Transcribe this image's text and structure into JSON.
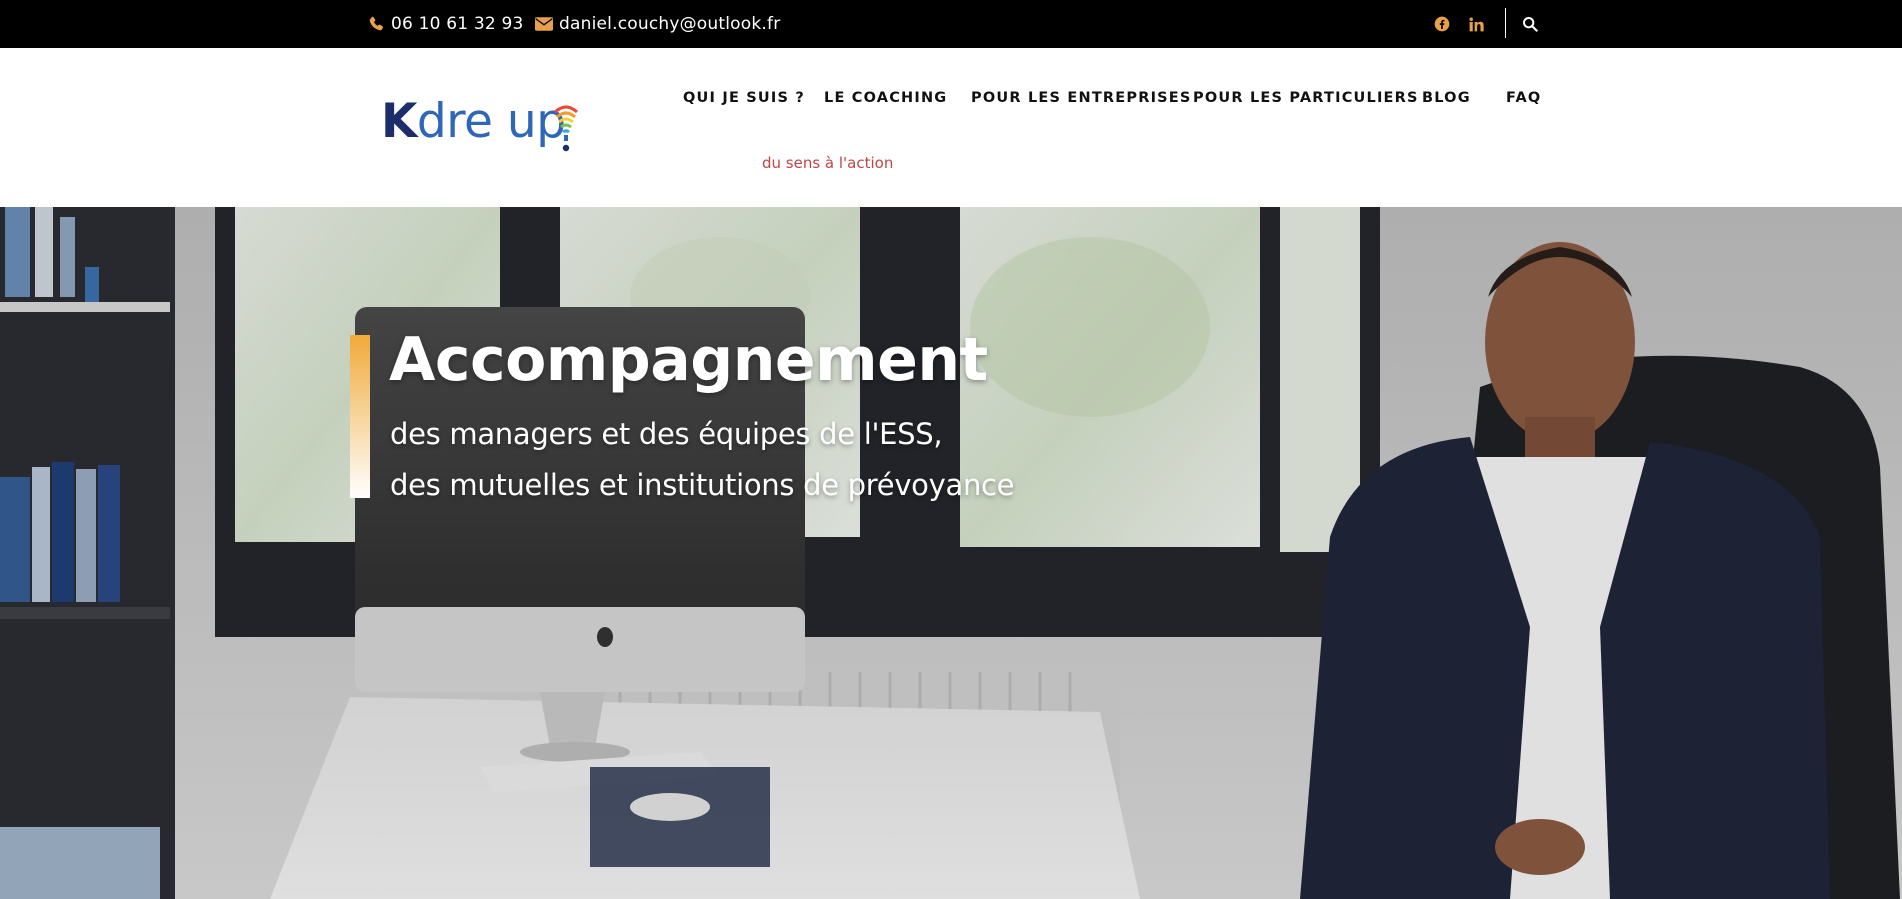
{
  "topbar": {
    "phone": "06 10 61 32 93",
    "email": "daniel.couchy@outlook.fr",
    "phone_icon": "phone-icon",
    "email_icon": "envelope-icon",
    "social": [
      {
        "icon": "facebook-icon"
      },
      {
        "icon": "linkedin-icon"
      }
    ],
    "search_icon": "search-icon",
    "accent_color": "#e8a04b"
  },
  "logo": {
    "letter_k": "K",
    "text_rest": "dre up",
    "tagline": "du sens à l'action"
  },
  "nav": {
    "items": [
      {
        "label": "QUI JE SUIS ?"
      },
      {
        "label": "LE COACHING"
      },
      {
        "label": "POUR LES ENTREPRISES"
      },
      {
        "label": "POUR LES PARTICULIERS"
      },
      {
        "label": "BLOG"
      },
      {
        "label": "FAQ"
      }
    ]
  },
  "hero": {
    "title": "Accompagnement",
    "subtitle_line1": "des managers et des équipes de l'ESS,",
    "subtitle_line2": "des mutuelles et institutions de prévoyance",
    "accent_color": "#f1a93a"
  }
}
